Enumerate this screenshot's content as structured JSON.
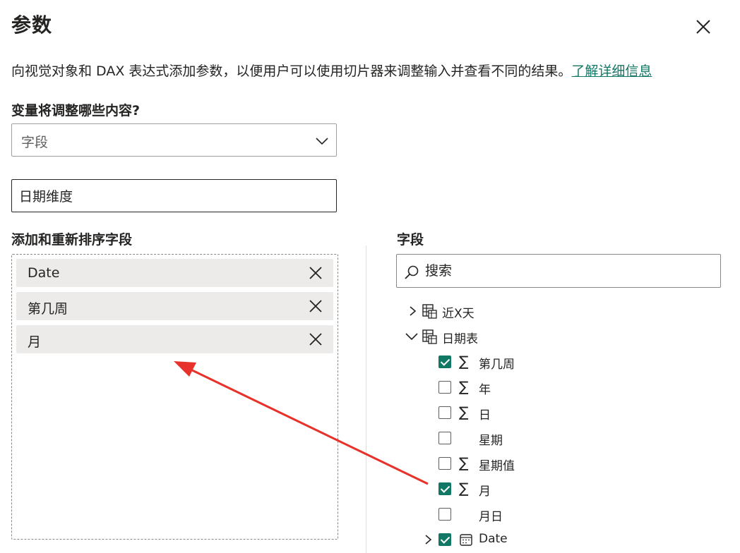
{
  "dialog": {
    "title": "参数",
    "description": "向视觉对象和 DAX 表达式添加参数，以便用户可以使用切片器来调整输入并查看不同的结果。",
    "learn_more": "了解详细信息"
  },
  "variable": {
    "label": "变量将调整哪些内容?",
    "selected": "字段"
  },
  "name_input": {
    "value": "日期维度"
  },
  "reorder": {
    "label": "添加和重新排序字段",
    "items": [
      {
        "label": "Date"
      },
      {
        "label": "第几周"
      },
      {
        "label": "月"
      }
    ]
  },
  "fields_pane": {
    "title": "字段",
    "search_placeholder": "搜索",
    "tables": [
      {
        "name": "近X天",
        "expanded": false
      },
      {
        "name": "日期表",
        "expanded": true
      }
    ],
    "columns": [
      {
        "label": "第几周",
        "checked": true,
        "sigma": true
      },
      {
        "label": "年",
        "checked": false,
        "sigma": true
      },
      {
        "label": "日",
        "checked": false,
        "sigma": true
      },
      {
        "label": "星期",
        "checked": false,
        "sigma": false
      },
      {
        "label": "星期值",
        "checked": false,
        "sigma": true
      },
      {
        "label": "月",
        "checked": true,
        "sigma": true
      },
      {
        "label": "月日",
        "checked": false,
        "sigma": false
      },
      {
        "label": "Date",
        "checked": true,
        "sigma": false,
        "icon": "calendar-icon"
      }
    ]
  },
  "colors": {
    "accent": "#117865",
    "arrow": "#e8312a",
    "chip_bg": "#edebe9"
  },
  "sigma_glyph": "∑"
}
